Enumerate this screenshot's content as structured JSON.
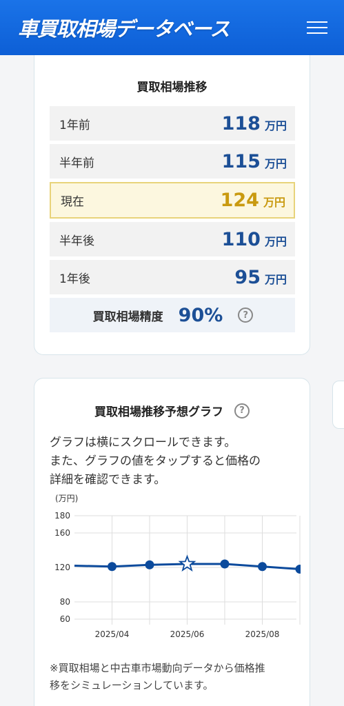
{
  "header": {
    "logo": "車買取相場データベース",
    "menu_icon": "hamburger-icon"
  },
  "trend": {
    "title": "買取相場推移",
    "rows": [
      {
        "label": "1年前",
        "value": "118",
        "unit": "万円"
      },
      {
        "label": "半年前",
        "value": "115",
        "unit": "万円"
      },
      {
        "label": "現在",
        "value": "124",
        "unit": "万円"
      },
      {
        "label": "半年後",
        "value": "110",
        "unit": "万円"
      },
      {
        "label": "1年後",
        "value": "95",
        "unit": "万円"
      }
    ],
    "accuracy_label": "買取相場精度",
    "accuracy_value": "90%",
    "help_icon": "question-circle-icon"
  },
  "graph": {
    "title": "買取相場推移予想グラフ",
    "help_icon": "question-circle-icon",
    "desc_line1": "グラフは横にスクロールできます。",
    "desc_line2": "また、グラフの値をタップすると価格の",
    "desc_line3": "詳細を確認できます。",
    "note_line1": "※買取相場と中古車市場動向データから価格推",
    "note_line2": "移をシミュレーションしています。"
  },
  "chart_data": {
    "type": "line",
    "ylabel": "(万円)",
    "y_ticks": [
      60,
      80,
      120,
      160,
      180
    ],
    "ylim": [
      60,
      180
    ],
    "x_tick_labels": [
      "2025/04",
      "2025/06",
      "2025/08"
    ],
    "x": [
      "2025/03",
      "2025/04",
      "2025/05",
      "2025/06",
      "2025/07",
      "2025/08",
      "2025/09"
    ],
    "series": [
      {
        "values": [
          122,
          121,
          123,
          124,
          124,
          121,
          118
        ],
        "highlight_index": 3
      }
    ],
    "colors": {
      "line": "#0b4a9c",
      "grid": "#dddddd"
    }
  }
}
